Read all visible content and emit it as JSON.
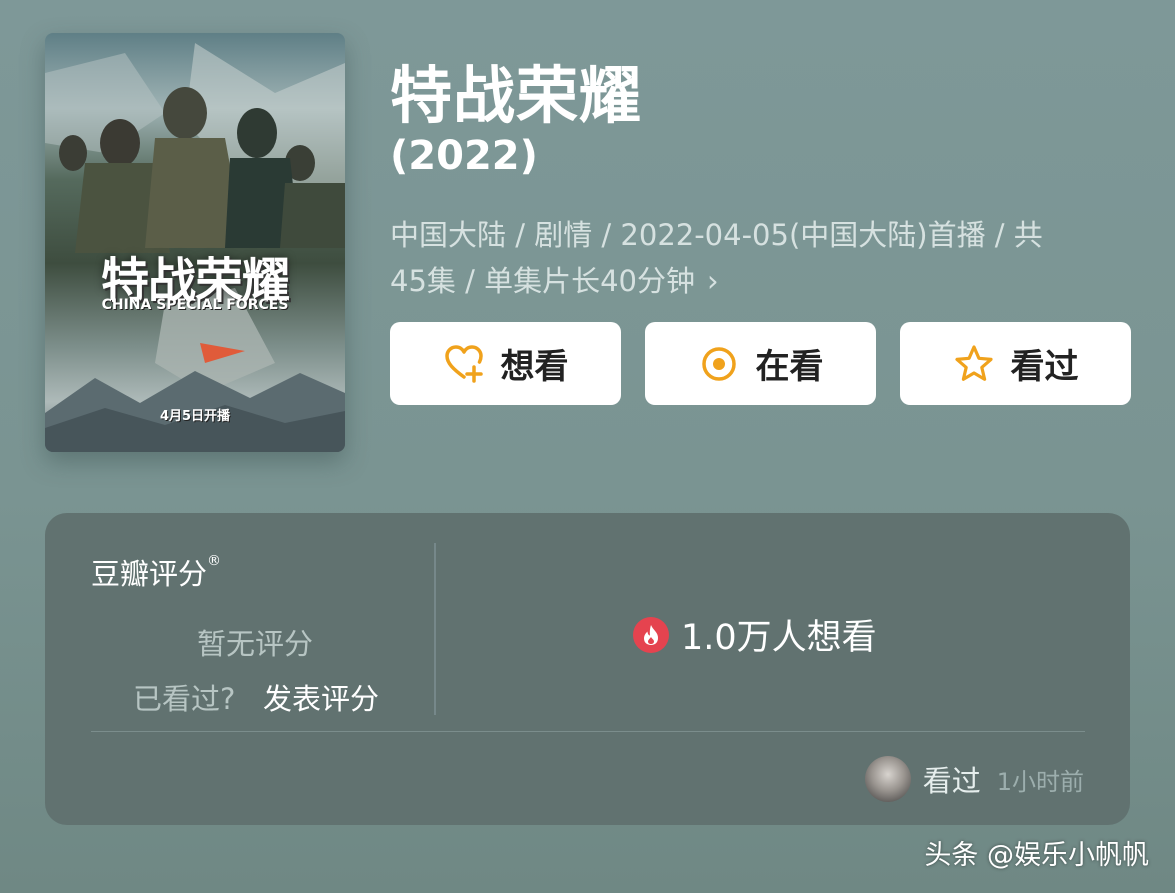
{
  "poster": {
    "title": "特战荣耀",
    "subtitle": "CHINA SPECIAL FORCES",
    "release": "4月5日开播"
  },
  "title": "特战荣耀",
  "year": "(2022)",
  "meta_line1": "中国大陆 / 剧情 / 2022-04-05(中国大陆)首播 / 共",
  "meta_line2": "45集 / 单集片长40分钟",
  "meta_chevron": "›",
  "buttons": {
    "want": "想看",
    "watching": "在看",
    "watched": "看过"
  },
  "rating": {
    "label": "豆瓣评分",
    "mark": "®",
    "none": "暂无评分",
    "seen_question": "已看过?",
    "post_link": "发表评分"
  },
  "want_count": "1.0万人想看",
  "activity": {
    "label": "看过",
    "time": "1小时前"
  },
  "watermark": "头条 @娱乐小帆帆",
  "colors": {
    "accent": "#f0a21c",
    "flame": "#e5434f",
    "card": "#617270"
  }
}
